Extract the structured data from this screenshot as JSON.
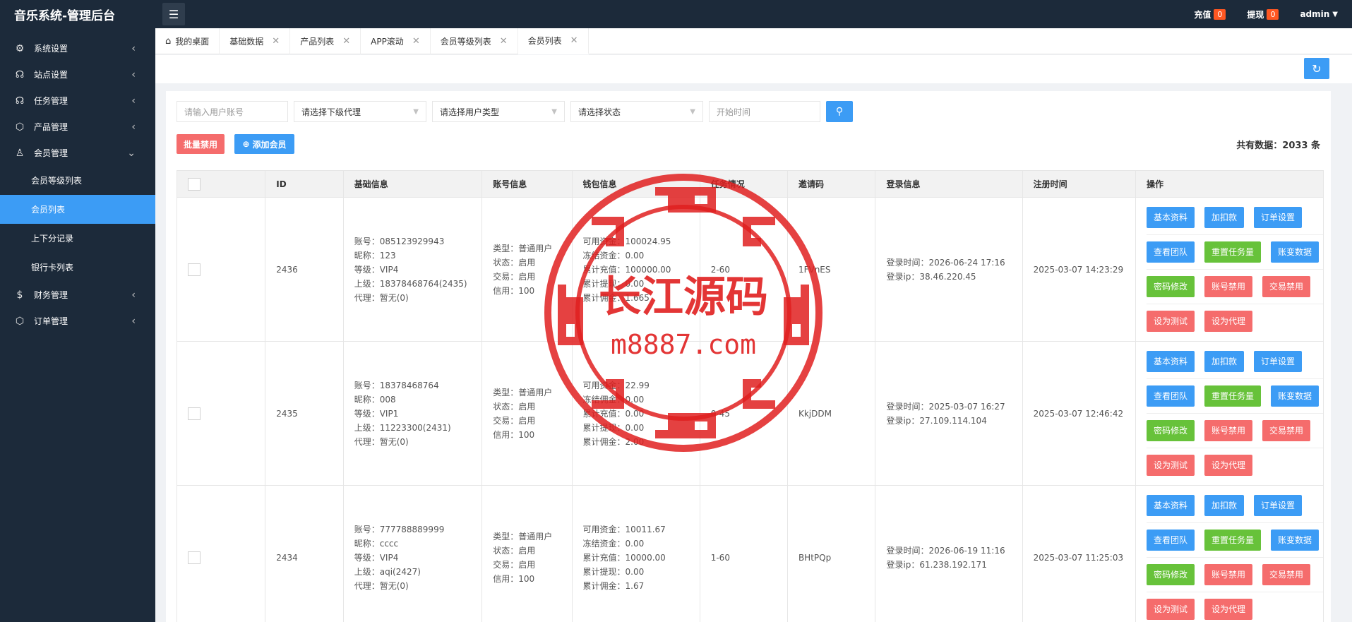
{
  "app": {
    "title": "音乐系统-管理后台"
  },
  "top": {
    "recharge_label": "充值",
    "recharge_count": "0",
    "withdraw_label": "提现",
    "withdraw_count": "0",
    "user": "admin"
  },
  "sidebar": {
    "items": [
      {
        "label": "系统设置",
        "icon": "gear-icon"
      },
      {
        "label": "站点设置",
        "icon": "headset-icon"
      },
      {
        "label": "任务管理",
        "icon": "headset-icon"
      },
      {
        "label": "产品管理",
        "icon": "box-icon"
      },
      {
        "label": "会员管理",
        "icon": "user-icon"
      }
    ],
    "sub": [
      "会员等级列表",
      "会员列表",
      "上下分记录",
      "银行卡列表"
    ],
    "items2": [
      {
        "label": "财务管理",
        "icon": "dollar-icon"
      },
      {
        "label": "订单管理",
        "icon": "box-icon"
      }
    ]
  },
  "tabs": [
    "我的桌面",
    "基础数据",
    "产品列表",
    "APP滚动",
    "会员等级列表",
    "会员列表"
  ],
  "filters": {
    "account_placeholder": "请输入用户账号",
    "agent_select": "请选择下级代理",
    "type_select": "请选择用户类型",
    "status_select": "请选择状态",
    "start_time_placeholder": "开始时间"
  },
  "toolbar": {
    "batch_disable": "批量禁用",
    "add_member": "添加会员",
    "total_label": "共有数据：",
    "total_count": "2033",
    "total_unit": " 条"
  },
  "table": {
    "headers": [
      "ID",
      "基础信息",
      "账号信息",
      "钱包信息",
      "任务情况",
      "邀请码",
      "登录信息",
      "注册时间",
      "操作"
    ],
    "rows": [
      {
        "id": "2436",
        "basic": [
          "账号：085123929943",
          "昵称：123",
          "等级：VIP4",
          "上级：18378468764(2435)",
          "代理：暂无(0)"
        ],
        "account": [
          "类型：普通用户",
          "状态：启用",
          "交易：启用",
          "信用：100"
        ],
        "wallet": [
          "可用资金：100024.95",
          "冻结资金：0.00",
          "累计充值：100000.00",
          "累计提现：0.00",
          "累计佣金：1.665"
        ],
        "task": "2-60",
        "invite": "1FVnES",
        "login": [
          "登录时间：2026-06-24 17:16",
          "登录ip：38.46.220.45"
        ],
        "reg": "2025-03-07 14:23:29"
      },
      {
        "id": "2435",
        "basic": [
          "账号：18378468764",
          "昵称：008",
          "等级：VIP1",
          "上级：11223300(2431)",
          "代理：暂无(0)"
        ],
        "account": [
          "类型：普通用户",
          "状态：启用",
          "交易：启用",
          "信用：100"
        ],
        "wallet": [
          "可用资金：22.99",
          "冻结佣金：0.00",
          "累计充值：0.00",
          "累计提现：0.00",
          "累计佣金：2.00"
        ],
        "task": "0-45",
        "invite": "KkjDDM",
        "login": [
          "登录时间：2025-03-07 16:27",
          "登录ip：27.109.114.104"
        ],
        "reg": "2025-03-07 12:46:42"
      },
      {
        "id": "2434",
        "basic": [
          "账号：777788889999",
          "昵称：cccc",
          "等级：VIP4",
          "上级：aqi(2427)",
          "代理：暂无(0)"
        ],
        "account": [
          "类型：普通用户",
          "状态：启用",
          "交易：启用",
          "信用：100"
        ],
        "wallet": [
          "可用资金：10011.67",
          "冻结资金：0.00",
          "累计充值：10000.00",
          "累计提现：0.00",
          "累计佣金：1.67"
        ],
        "task": "1-60",
        "invite": "BHtPQp",
        "login": [
          "登录时间：2026-06-19 11:16",
          "登录ip：61.238.192.171"
        ],
        "reg": "2025-03-07 11:25:03"
      }
    ],
    "ops": [
      [
        {
          "label": "基本资料",
          "color": "blue"
        },
        {
          "label": "加扣款",
          "color": "blue"
        },
        {
          "label": "订单设置",
          "color": "blue"
        }
      ],
      [
        {
          "label": "查看团队",
          "color": "blue"
        },
        {
          "label": "重置任务量",
          "color": "green"
        },
        {
          "label": "账变数据",
          "color": "blue"
        }
      ],
      [
        {
          "label": "密码修改",
          "color": "green"
        },
        {
          "label": "账号禁用",
          "color": "red"
        },
        {
          "label": "交易禁用",
          "color": "red"
        }
      ],
      [
        {
          "label": "设为测试",
          "color": "red"
        },
        {
          "label": "设为代理",
          "color": "red"
        }
      ]
    ]
  },
  "watermark": {
    "line1": "长江源码",
    "line2": "m8887.com"
  },
  "colors": {
    "sidebar_bg": "#1c2a3a",
    "accent": "#3c9cf5",
    "danger": "#f56c6c",
    "success": "#67c23a",
    "badge": "#ff5722"
  }
}
